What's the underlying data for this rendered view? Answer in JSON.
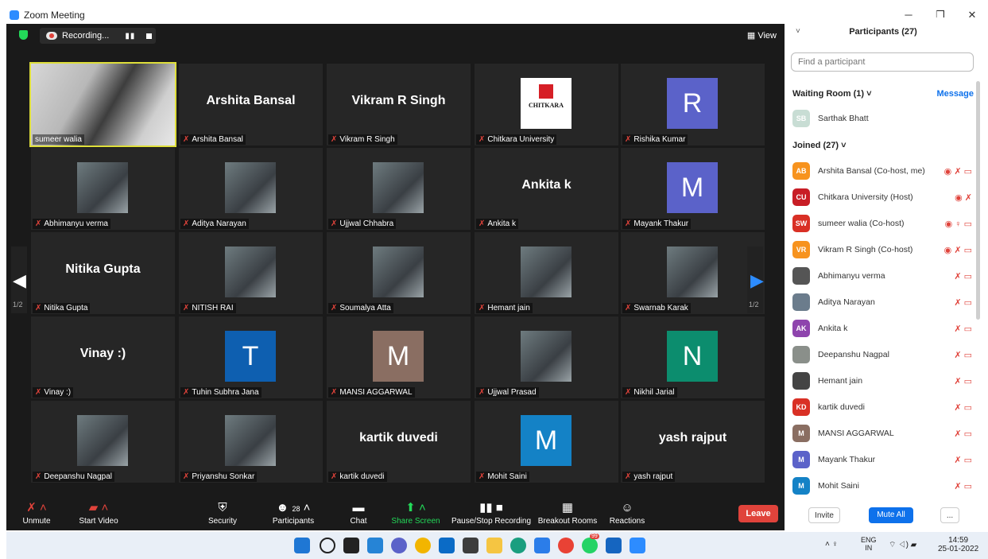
{
  "window": {
    "title": "Zoom Meeting",
    "minimize": "─",
    "maximize": "❐",
    "close": "✕"
  },
  "topbar": {
    "recording_label": "Recording...",
    "view_label": "View"
  },
  "tiles": [
    {
      "name": "sumeer walia",
      "label": "sumeer walia",
      "kind": "video",
      "muted": false
    },
    {
      "name": "Arshita Bansal",
      "label": "Arshita Bansal",
      "kind": "text",
      "muted": true
    },
    {
      "name": "Vikram R Singh",
      "label": "Vikram R Singh",
      "kind": "text",
      "muted": true
    },
    {
      "name": "Chitkara University",
      "label": "Chitkara University",
      "kind": "logo",
      "muted": true
    },
    {
      "name": "Rishika Kumar",
      "label": "Rishika Kumar",
      "kind": "letter",
      "letter": "R",
      "color": "#5b62c9",
      "muted": true
    },
    {
      "name": "Abhimanyu verma",
      "label": "Abhimanyu verma",
      "kind": "photo",
      "muted": true
    },
    {
      "name": "Aditya Narayan",
      "label": "Aditya Narayan",
      "kind": "photo",
      "muted": true
    },
    {
      "name": "Ujjwal Chhabra",
      "label": "Ujjwal Chhabra",
      "kind": "photo",
      "muted": true
    },
    {
      "name": "Ankita k",
      "label": "Ankita k",
      "kind": "text",
      "muted": true
    },
    {
      "name": "Mayank Thakur",
      "label": "Mayank Thakur",
      "kind": "letter",
      "letter": "M",
      "color": "#5b62c9",
      "muted": true
    },
    {
      "name": "Nitika Gupta",
      "label": "Nitika Gupta",
      "kind": "text",
      "muted": true
    },
    {
      "name": "NITISH RAI",
      "label": "NITISH RAI",
      "kind": "photo",
      "muted": true
    },
    {
      "name": "Soumalya Atta",
      "label": "Soumalya Atta",
      "kind": "photo",
      "muted": true
    },
    {
      "name": "Hemant jain",
      "label": "Hemant jain",
      "kind": "photo",
      "muted": true
    },
    {
      "name": "Swarnab Karak",
      "label": "Swarnab Karak",
      "kind": "photo",
      "muted": true
    },
    {
      "name": "Vinay :)",
      "label": "Vinay :)",
      "kind": "text",
      "muted": true
    },
    {
      "name": "Tuhin Subhra Jana",
      "label": "Tuhin Subhra Jana",
      "kind": "letter",
      "letter": "T",
      "color": "#0e5fb0",
      "muted": true
    },
    {
      "name": "MANSI AGGARWAL",
      "label": "MANSI AGGARWAL",
      "kind": "letter",
      "letter": "M",
      "color": "#8a6e62",
      "muted": true
    },
    {
      "name": "Ujjwal Prasad",
      "label": "Ujjwal Prasad",
      "kind": "photo",
      "muted": true
    },
    {
      "name": "Nikhil Jarial",
      "label": "Nikhil Jarial",
      "kind": "letter",
      "letter": "N",
      "color": "#0c8d6e",
      "muted": true
    },
    {
      "name": "Deepanshu Nagpal",
      "label": "Deepanshu Nagpal",
      "kind": "photo",
      "muted": true
    },
    {
      "name": "Priyanshu Sonkar",
      "label": "Priyanshu Sonkar",
      "kind": "photo",
      "muted": true
    },
    {
      "name": "kartik duvedi",
      "label": "kartik duvedi",
      "kind": "text",
      "muted": true
    },
    {
      "name": "Mohit Saini",
      "label": "Mohit Saini",
      "kind": "letter",
      "letter": "M",
      "color": "#1482c6",
      "muted": true
    },
    {
      "name": "yash rajput",
      "label": "yash rajput",
      "kind": "text",
      "muted": true
    }
  ],
  "pager": {
    "left": "1/2",
    "right": "1/2"
  },
  "toolbar": {
    "unmute": "Unmute",
    "start_video": "Start Video",
    "security": "Security",
    "participants": "Participants",
    "participants_count": "28",
    "chat": "Chat",
    "share_screen": "Share Screen",
    "pause_recording": "Pause/Stop Recording",
    "breakout": "Breakout Rooms",
    "reactions": "Reactions",
    "leave": "Leave"
  },
  "panel": {
    "title": "Participants (27)",
    "search_placeholder": "Find a participant",
    "waiting_room": "Waiting Room (1)",
    "message": "Message",
    "waiting": [
      {
        "initials": "SB",
        "name": "Sarthak Bhatt",
        "color": "#c8ddd4"
      }
    ],
    "joined": "Joined (27)",
    "participants": [
      {
        "initials": "AB",
        "name": "Arshita Bansal (Co-host, me)",
        "color": "#f7931e",
        "icons": "◉ ✗ ▭"
      },
      {
        "initials": "CU",
        "name": "Chitkara University (Host)",
        "color": "#c81d25",
        "icons": "◉ ✗"
      },
      {
        "initials": "SW",
        "name": "sumeer walia (Co-host)",
        "color": "#d93025",
        "icons": "◉ ♀ ▭"
      },
      {
        "initials": "VR",
        "name": "Vikram R Singh (Co-host)",
        "color": "#f7931e",
        "icons": "◉ ✗ ▭"
      },
      {
        "initials": "",
        "name": "Abhimanyu verma",
        "color": "#555",
        "icons": "✗ ▭"
      },
      {
        "initials": "",
        "name": "Aditya Narayan",
        "color": "#6b7c8c",
        "icons": "✗ ▭"
      },
      {
        "initials": "AK",
        "name": "Ankita k",
        "color": "#8e44ad",
        "icons": "✗ ▭"
      },
      {
        "initials": "",
        "name": "Deepanshu Nagpal",
        "color": "#8a8f8a",
        "icons": "✗ ▭"
      },
      {
        "initials": "",
        "name": "Hemant jain",
        "color": "#444",
        "icons": "✗ ▭"
      },
      {
        "initials": "KD",
        "name": "kartik duvedi",
        "color": "#d93025",
        "icons": "✗ ▭"
      },
      {
        "initials": "M",
        "name": "MANSI AGGARWAL",
        "color": "#8a6e62",
        "icons": "✗ ▭"
      },
      {
        "initials": "M",
        "name": "Mayank Thakur",
        "color": "#5b62c9",
        "icons": "✗ ▭"
      },
      {
        "initials": "M",
        "name": "Mohit Saini",
        "color": "#1482c6",
        "icons": "✗ ▭"
      }
    ],
    "invite": "Invite",
    "mute_all": "Mute All",
    "more": "..."
  },
  "taskbar": {
    "lang": "ENG",
    "region": "IN",
    "time": "14:59",
    "date": "25-01-2022",
    "badge": "99"
  }
}
